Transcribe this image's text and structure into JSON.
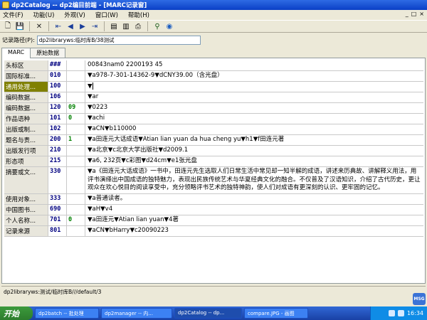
{
  "window": {
    "title": "dp2Catalog -- dp2编目前端 - [MARC记录窗]"
  },
  "menu": [
    {
      "label": "文件(F)"
    },
    {
      "label": "功能(U)"
    },
    {
      "label": "外观(V)"
    },
    {
      "label": "窗口(W)"
    },
    {
      "label": "帮助(H)"
    }
  ],
  "menu_right": {
    "min": "_",
    "restore": "□",
    "close": "×"
  },
  "record_path": {
    "label": "记录路径(P):",
    "value": "dp2libraryws:临时库B/38测试"
  },
  "tabs": [
    {
      "label": "MARC"
    },
    {
      "label": "原始数据"
    }
  ],
  "marc_rows": [
    {
      "name": "头标区",
      "tag": "###",
      "ind": "",
      "value": "00843nam0 2200193   45"
    },
    {
      "name": "国际标准...",
      "tag": "010",
      "ind": "",
      "value": "▼a978-7-301-14362-9▼dCNY39.00（含光盘）"
    },
    {
      "name": "通用处理...",
      "tag": "100",
      "ind": "",
      "value": "▼"
    },
    {
      "name": "编码数据...",
      "tag": "106",
      "ind": "",
      "value": "▼ar"
    },
    {
      "name": "编码数据...",
      "tag": "120",
      "ind": "09",
      "value": "▼0223"
    },
    {
      "name": "作品语种",
      "tag": "101",
      "ind": "0",
      "value": "▼achi"
    },
    {
      "name": "出版或制...",
      "tag": "102",
      "ind": "",
      "value": "▼aCN▼b110000"
    },
    {
      "name": "题名与责...",
      "tag": "200",
      "ind": "1",
      "value": "▼a田连元大话成语▼Atian lian yuan da hua cheng yu▼h1▼f田连元著"
    },
    {
      "name": "出版发行项",
      "tag": "210",
      "ind": "",
      "value": "▼a北京▼c北京大学出版社▼d2009.1"
    },
    {
      "name": "形态项",
      "tag": "215",
      "ind": "",
      "value": "▼a6, 232页▼c彩图▼d24cm▼e1张光盘"
    },
    {
      "name": "摘要或文...",
      "tag": "330",
      "ind": "",
      "value": "▼a《田连元大话成语》一书中，田连元先生选取人们日常生活中常见却一知半解的成语，讲述来历典故、讲解释义用法，用评书演绎出中国成语的独特魅力，表现出民族传统艺术与华夏经典文化的融合。不仅普及了汉语知识，介绍了古代历史，更让观众在欢心悦目的阅读享受中，充分领略评书艺术的独特神韵，使人们对成语有更深刻的认识、更牢固的记忆。"
    },
    {
      "name": "使用对象...",
      "tag": "333",
      "ind": "",
      "value": "▼a普通读者。"
    },
    {
      "name": "中国图书...",
      "tag": "690",
      "ind": "",
      "value": "▼aH▼v4"
    },
    {
      "name": "个人名称...",
      "tag": "701",
      "ind": "0",
      "value": "▼a田连元▼Atian lian yuan▼4著"
    },
    {
      "name": "记录来源",
      "tag": "801",
      "ind": "",
      "value": "▼aCN▼bHarry▼c20090223"
    }
  ],
  "status": {
    "text": "dp2libraryws:测试/临时库B///default/3"
  },
  "taskbar": {
    "start": "开始",
    "tasks": [
      {
        "label": "dp2batch -- 批处理"
      },
      {
        "label": "dp2manager -- 内..."
      },
      {
        "label": "dp2Catalog -- dp..."
      },
      {
        "label": "compare.JPG - 画图"
      }
    ],
    "clock": "16:34"
  },
  "msn_badge": "MSG",
  "colors": {
    "selected_name": "#808000",
    "tag": "#000080",
    "indicator": "#008000",
    "titlebar": "#0a3fc6"
  }
}
